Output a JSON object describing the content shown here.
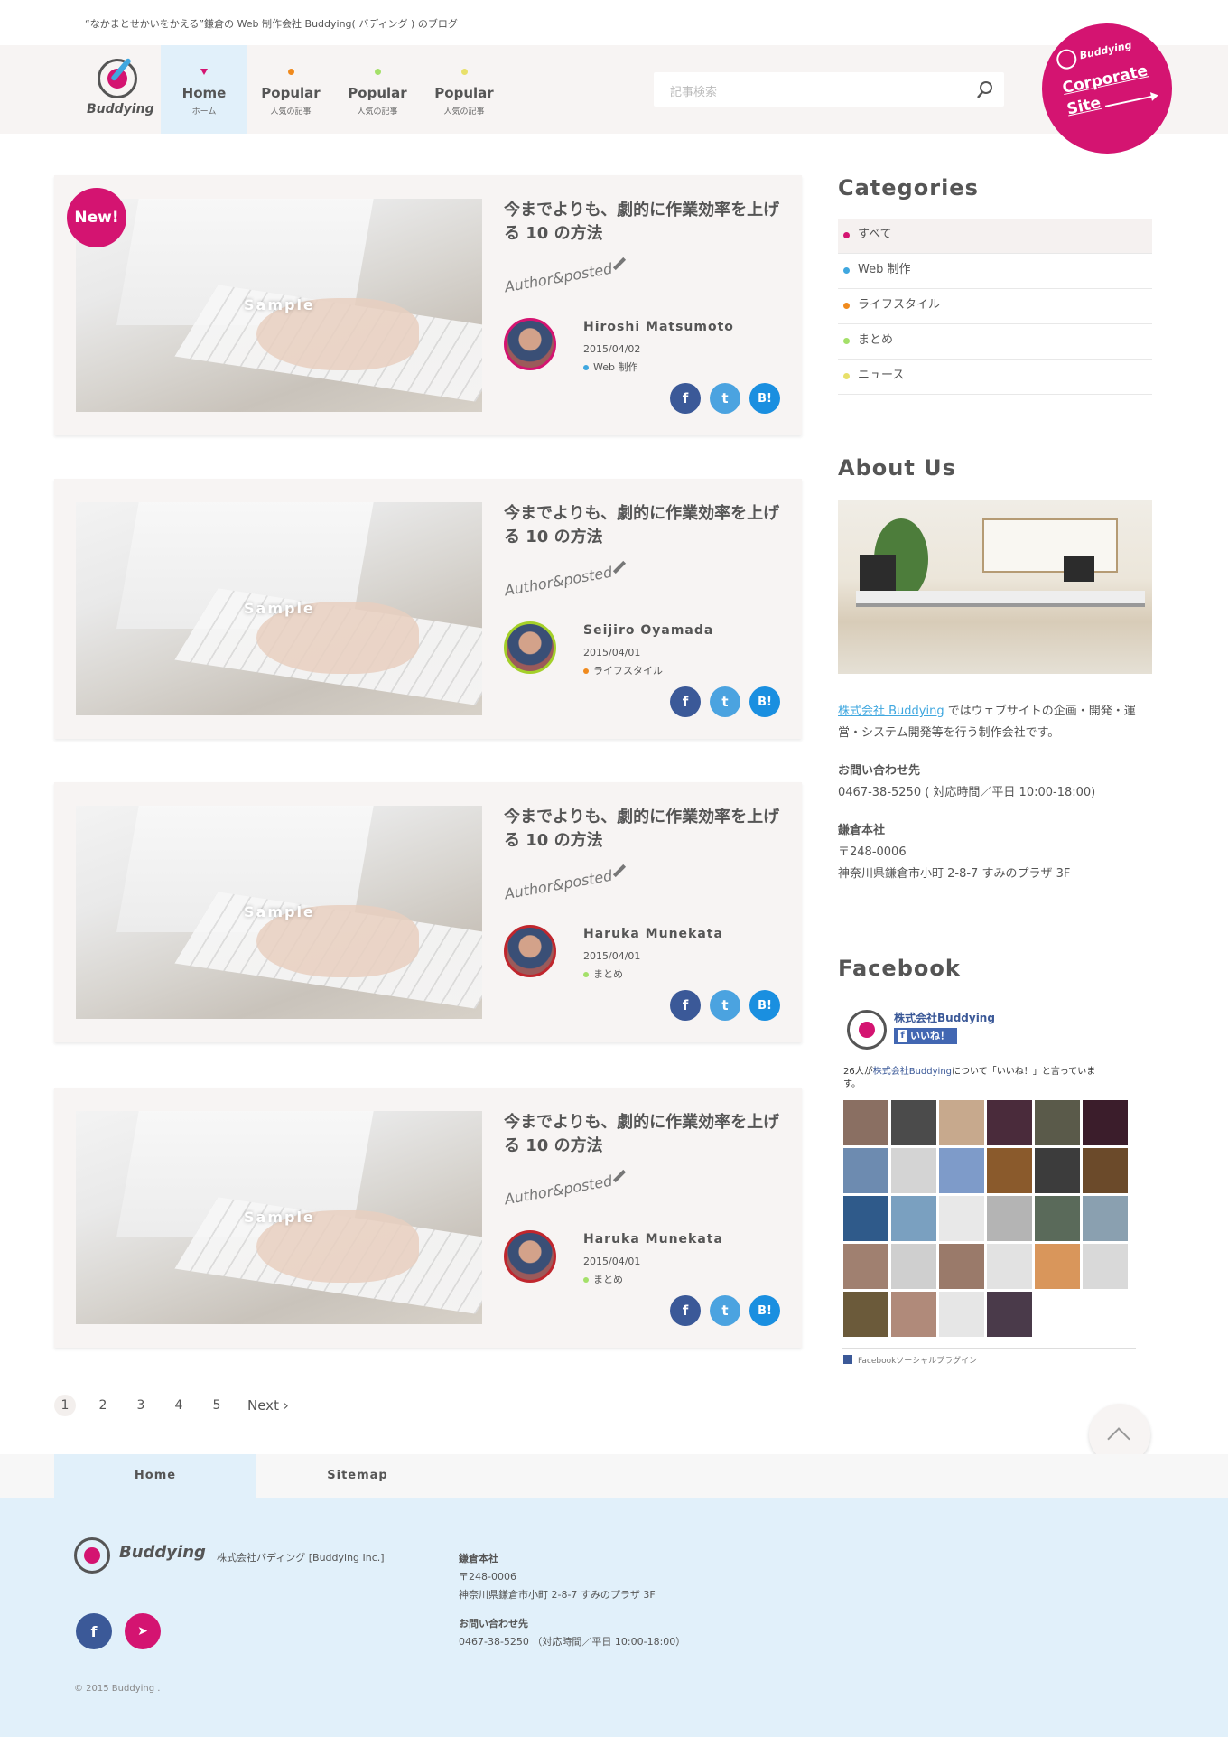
{
  "tagline": "“なかまとせかいをかえる”鎌倉の Web 制作会社 Buddying( バディング ) のブログ",
  "logo_text": "Buddying",
  "nav": [
    {
      "main": "Home",
      "sub": "ホーム",
      "active": true,
      "color": "#d41471"
    },
    {
      "main": "Popular",
      "sub": "人気の記事",
      "active": false,
      "color": "#f08a1d"
    },
    {
      "main": "Popular",
      "sub": "人気の記事",
      "active": false,
      "color": "#a4e069"
    },
    {
      "main": "Popular",
      "sub": "人気の記事",
      "active": false,
      "color": "#e8e06a"
    }
  ],
  "search": {
    "placeholder": "記事検索"
  },
  "corporate": {
    "brand": "Buddying",
    "line1": "Corporate",
    "line2": "Site",
    "color": "#d41471"
  },
  "posts": [
    {
      "new_badge": "New!",
      "thumb_label": "Sample",
      "title": "今までよりも、劇的に作業効率を上げる 10 の方法",
      "author_label": "Author&posted",
      "author": "Hiroshi Matsumoto",
      "date": "2015/04/02",
      "category": "Web 制作",
      "category_color": "#3fa7df",
      "avatar_border": "#d41471"
    },
    {
      "new_badge": "",
      "thumb_label": "Sample",
      "title": "今までよりも、劇的に作業効率を上げる 10 の方法",
      "author_label": "Author&posted",
      "author": "Seijiro Oyamada",
      "date": "2015/04/01",
      "category": "ライフスタイル",
      "category_color": "#f08a1d",
      "avatar_border": "#a4d029"
    },
    {
      "new_badge": "",
      "thumb_label": "Sample",
      "title": "今までよりも、劇的に作業効率を上げる 10 の方法",
      "author_label": "Author&posted",
      "author": "Haruka Munekata",
      "date": "2015/04/01",
      "category": "まとめ",
      "category_color": "#a4e069",
      "avatar_border": "#c0262d"
    },
    {
      "new_badge": "",
      "thumb_label": "Sample",
      "title": "今までよりも、劇的に作業効率を上げる 10 の方法",
      "author_label": "Author&posted",
      "author": "Haruka Munekata",
      "date": "2015/04/01",
      "category": "まとめ",
      "category_color": "#a4e069",
      "avatar_border": "#c0262d"
    }
  ],
  "share": {
    "fb": "f",
    "tw": "t",
    "hb": "B!"
  },
  "pagination": {
    "pages": [
      "1",
      "2",
      "3",
      "4",
      "5"
    ],
    "current": "1",
    "next": "Next ›"
  },
  "sidebar": {
    "categories_heading": "Categories",
    "categories": [
      {
        "label": "すべて",
        "color": "#d41471",
        "active": true
      },
      {
        "label": "Web 制作",
        "color": "#3fa7df",
        "active": false
      },
      {
        "label": "ライフスタイル",
        "color": "#f08a1d",
        "active": false
      },
      {
        "label": "まとめ",
        "color": "#a4e069",
        "active": false
      },
      {
        "label": "ニュース",
        "color": "#e8e06a",
        "active": false
      }
    ],
    "about_heading": "About Us",
    "about_link": "株式会社 Buddying",
    "about_desc": " ではウェブサイトの企画・開発・運営・システム開発等を行う制作会社です。",
    "contact_heading": "お問い合わせ先",
    "contact_value": "0467-38-5250 ( 対応時間／平日 10:00-18:00)",
    "hq_heading": "鎌倉本社",
    "hq_zip": "〒248-0006",
    "hq_address": "神奈川県鎌倉市小町 2-8-7 すみのプラザ 3F",
    "facebook_heading": "Facebook",
    "fb_page_name": "株式会社Buddying",
    "fb_like": "いいね！",
    "fb_count_prefix": "26人が",
    "fb_count_link": "株式会社Buddying",
    "fb_count_suffix": "について「いいね！」と言っています。",
    "fb_plugin": "Facebookソーシャルプラグイン"
  },
  "footer_nav": [
    {
      "label": "Home",
      "active": true
    },
    {
      "label": "Sitemap",
      "active": false
    }
  ],
  "footer": {
    "logo_text": "Buddying",
    "company": "株式会社バディング [Buddying Inc.]",
    "hq_heading": "鎌倉本社",
    "hq_zip": "〒248-0006",
    "hq_address": "神奈川県鎌倉市小町 2-8-7 すみのプラザ 3F",
    "contact_heading": "お問い合わせ先",
    "contact_value": "0467-38-5250 （対応時間／平日 10:00-18:00）",
    "copyright": "© 2015 Buddying .",
    "fb_icon": "f",
    "mail_icon": "➤"
  }
}
